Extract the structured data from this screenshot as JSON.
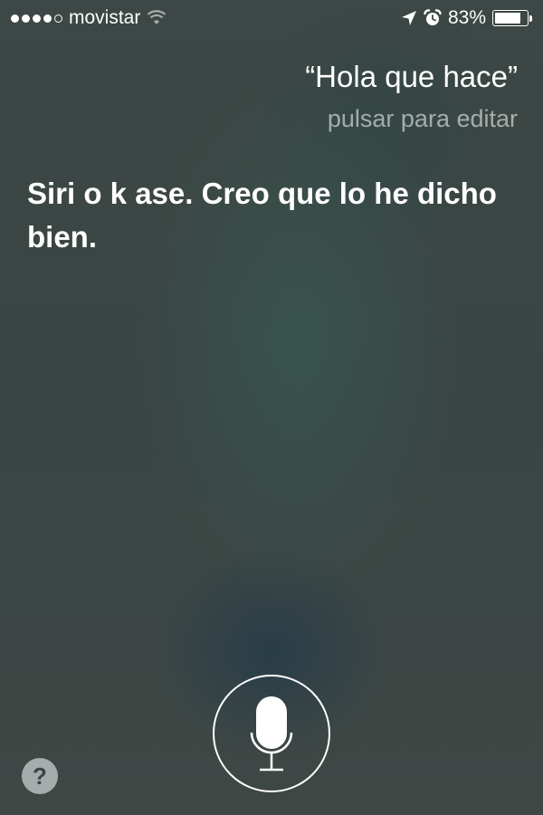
{
  "status_bar": {
    "carrier": "movistar",
    "signal_bars_filled": 4,
    "signal_bars_total": 5,
    "icons": [
      "signal-dots-icon",
      "wifi-icon",
      "location-arrow-icon",
      "alarm-clock-icon",
      "battery-icon"
    ],
    "battery_percent": "83%",
    "battery_level": 0.83
  },
  "siri": {
    "user_query": "“Hola que hace”",
    "edit_hint": "pulsar para editar",
    "response": "Siri o k ase. Creo que lo he dicho bien."
  },
  "controls": {
    "help_label": "?",
    "mic_icon": "microphone-icon"
  },
  "colors": {
    "background": "#3b4542",
    "text": "#ffffff",
    "hint_text": "#9aa09f"
  }
}
